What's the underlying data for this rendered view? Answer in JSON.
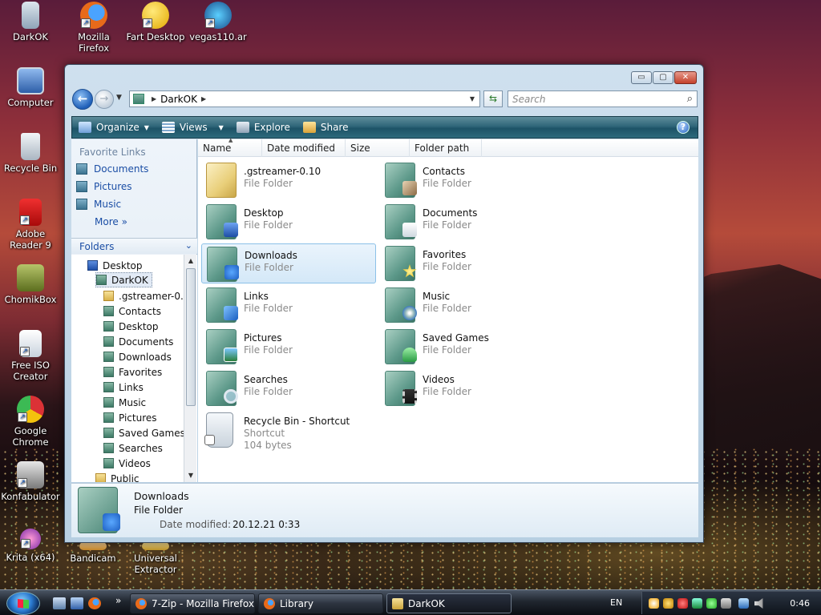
{
  "desktop": {
    "icons": [
      {
        "label": "DarkOK",
        "icon": "folder-zip-icon"
      },
      {
        "label": "Mozilla Firefox",
        "icon": "firefox-icon"
      },
      {
        "label": "Fart Desktop",
        "icon": "smiley-icon"
      },
      {
        "label": "vegas110.ar",
        "icon": "installer-icon"
      },
      {
        "label": "Computer",
        "icon": "computer-icon"
      },
      {
        "label": "Recycle Bin",
        "icon": "recycle-bin-icon"
      },
      {
        "label": "Adobe Reader 9",
        "icon": "adobe-reader-icon"
      },
      {
        "label": "ChomikBox",
        "icon": "chomikbox-icon"
      },
      {
        "label": "Free ISO Creator",
        "icon": "iso-creator-icon"
      },
      {
        "label": "Google Chrome",
        "icon": "chrome-icon"
      },
      {
        "label": "Konfabulator",
        "icon": "konfabulator-icon"
      },
      {
        "label": "Krita (x64)",
        "icon": "krita-icon"
      },
      {
        "label": "Bandicam",
        "icon": "bandicam-icon"
      },
      {
        "label": "Universal Extractor",
        "icon": "extractor-icon"
      }
    ]
  },
  "window": {
    "caption": {
      "minimize": "▭",
      "maximize": "▢",
      "close": "✕"
    },
    "address": {
      "path": "DarkOK"
    },
    "search": {
      "placeholder": "Search"
    },
    "toolbar": {
      "organize": "Organize",
      "views": "Views",
      "explore": "Explore",
      "share": "Share",
      "help": "?"
    },
    "favorite_links": {
      "title": "Favorite Links",
      "items": [
        "Documents",
        "Pictures",
        "Music"
      ],
      "more": "More"
    },
    "folders": {
      "title": "Folders",
      "tree": [
        "Desktop",
        "DarkOK",
        ".gstreamer-0.10",
        "Contacts",
        "Desktop",
        "Documents",
        "Downloads",
        "Favorites",
        "Links",
        "Music",
        "Pictures",
        "Saved Games",
        "Searches",
        "Videos",
        "Public"
      ]
    },
    "columns": [
      "Name",
      "Date modified",
      "Size",
      "Folder path"
    ],
    "items": [
      {
        "name": ".gstreamer-0.10",
        "type": "File Folder",
        "icon": "folder-icon"
      },
      {
        "name": "Contacts",
        "type": "File Folder",
        "icon": "contacts-folder-icon"
      },
      {
        "name": "Desktop",
        "type": "File Folder",
        "icon": "desktop-folder-icon"
      },
      {
        "name": "Documents",
        "type": "File Folder",
        "icon": "documents-folder-icon"
      },
      {
        "name": "Downloads",
        "type": "File Folder",
        "icon": "downloads-folder-icon"
      },
      {
        "name": "Favorites",
        "type": "File Folder",
        "icon": "favorites-folder-icon"
      },
      {
        "name": "Links",
        "type": "File Folder",
        "icon": "links-folder-icon"
      },
      {
        "name": "Music",
        "type": "File Folder",
        "icon": "music-folder-icon"
      },
      {
        "name": "Pictures",
        "type": "File Folder",
        "icon": "pictures-folder-icon"
      },
      {
        "name": "Saved Games",
        "type": "File Folder",
        "icon": "saved-games-folder-icon"
      },
      {
        "name": "Searches",
        "type": "File Folder",
        "icon": "searches-folder-icon"
      },
      {
        "name": "Videos",
        "type": "File Folder",
        "icon": "videos-folder-icon"
      },
      {
        "name": "Recycle Bin - Shortcut",
        "type": "Shortcut",
        "size": "104 bytes",
        "icon": "recycle-bin-shortcut-icon"
      }
    ],
    "details": {
      "name": "Downloads",
      "type": "File Folder",
      "date_label": "Date modified:",
      "date_value": "20.12.21 0:33"
    }
  },
  "taskbar": {
    "buttons": [
      "7-Zip - Mozilla Firefox",
      "Library",
      "DarkOK"
    ],
    "more": "»",
    "language": "EN",
    "clock": "0:46"
  }
}
